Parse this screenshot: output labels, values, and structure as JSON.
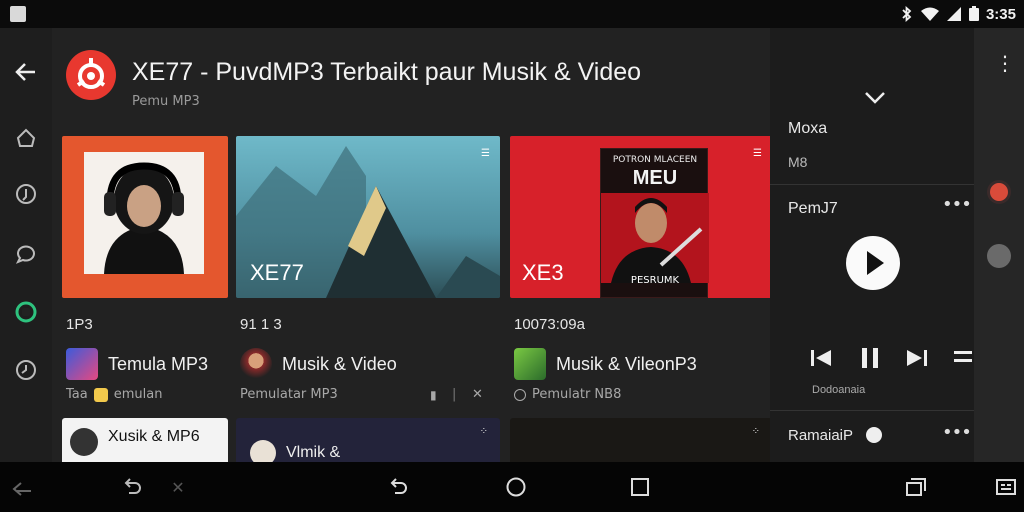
{
  "status": {
    "time": "3:35"
  },
  "header": {
    "title": "XE77 - PuvdMP3 Terbaikt paur Musik & Video",
    "subtitle": "Pemu MP3"
  },
  "cards": [
    {
      "meta": "1P3",
      "title": "Temula MP3",
      "sub_label": "emulan",
      "sub_prefix": "Taa",
      "thumb_caption": ""
    },
    {
      "meta": "91 1 3",
      "title": "Musik & Video",
      "sub_label": "Pemulatar MP3",
      "thumb_caption": "XE77"
    },
    {
      "meta": "10073:09a",
      "title": "Musik & VileonP3",
      "sub_label": "Pemulatr NB8",
      "thumb_caption": "XE3",
      "poster_title": "MEU",
      "poster_top": "POTRON MLACEEN",
      "poster_bottom": "PESRUMK"
    }
  ],
  "row2": [
    {
      "title": "Xusik & MP6"
    },
    {
      "title": "Vlmik &"
    }
  ],
  "panel": {
    "header_title": "Moxa",
    "header_sub": "M8",
    "now_playing": "PemJ7",
    "track_caption": "Dodoanaia",
    "next_label": "RamaiaiP"
  },
  "colors": {
    "accent_red": "#e8382f",
    "background": "#222222",
    "panel_bg": "#1c1c1c"
  }
}
